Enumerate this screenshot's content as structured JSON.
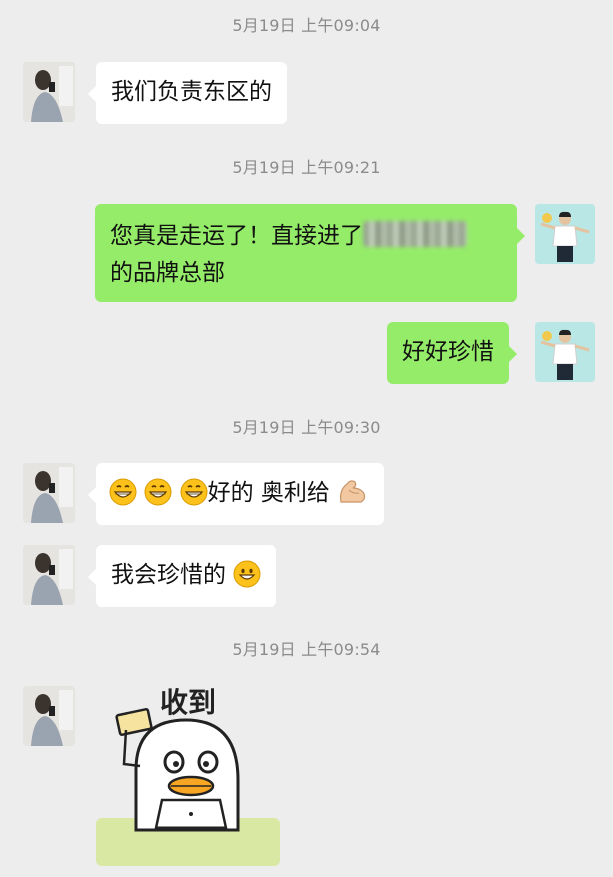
{
  "chat": {
    "timestamps": [
      "5月19日 上午09:04",
      "5月19日 上午09:21",
      "5月19日 上午09:30",
      "5月19日 上午09:54"
    ],
    "messages": [
      {
        "side": "in",
        "text": "我们负责东区的"
      },
      {
        "side": "out",
        "line1": "您真是走运了！直接进了",
        "line2": "的品牌总部"
      },
      {
        "side": "out",
        "text": "好好珍惜"
      },
      {
        "side": "in",
        "text_a": "好的 奥利给"
      },
      {
        "side": "in",
        "text": "我会珍惜的"
      }
    ],
    "sticker": {
      "caption": "收到"
    }
  },
  "colors": {
    "background": "#ededed",
    "outgoing_bubble": "#95ec69",
    "incoming_bubble": "#ffffff",
    "timestamp": "#8b8b8b"
  },
  "icons": [
    "grinning-face-icon",
    "flexed-biceps-icon",
    "smiling-face-icon",
    "duck-sticker"
  ]
}
